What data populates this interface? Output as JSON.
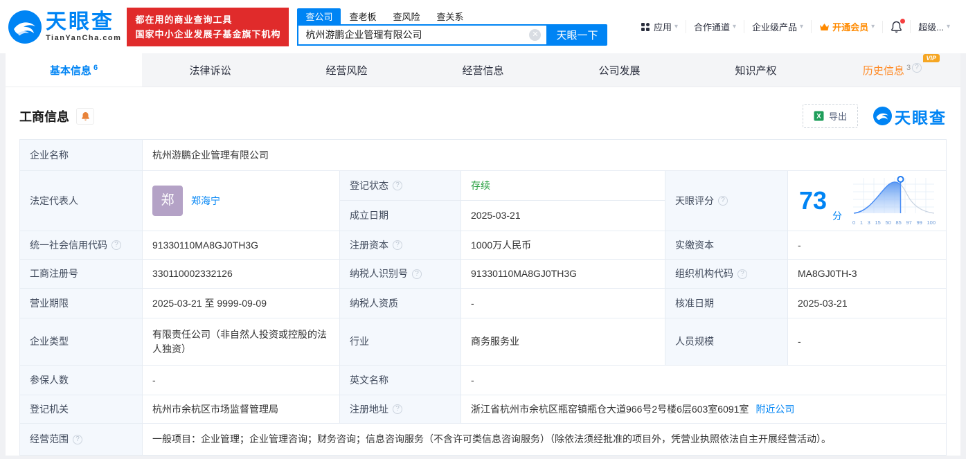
{
  "header": {
    "logo": {
      "name": "天眼查",
      "domain": "TianYanCha.com"
    },
    "promo": {
      "line1": "都在用的商业查询工具",
      "line2": "国家中小企业发展子基金旗下机构"
    },
    "search": {
      "tabs": [
        {
          "label": "查公司"
        },
        {
          "label": "查老板"
        },
        {
          "label": "查风险"
        },
        {
          "label": "查关系"
        }
      ],
      "value": "杭州游鹏企业管理有限公司",
      "button": "天眼一下"
    },
    "nav": {
      "apps": "应用",
      "partner": "合作通道",
      "enterprise": "企业级产品",
      "vip": "开通会员",
      "super": "超级..."
    }
  },
  "tabs": {
    "basic": {
      "label": "基本信息",
      "count": "6"
    },
    "legal": {
      "label": "法律诉讼"
    },
    "risk": {
      "label": "经营风险"
    },
    "operation": {
      "label": "经营信息"
    },
    "development": {
      "label": "公司发展"
    },
    "ip": {
      "label": "知识产权"
    },
    "history": {
      "label": "历史信息",
      "count": "3",
      "vip_badge": "VIP"
    }
  },
  "section": {
    "title": "工商信息",
    "export": "导出",
    "watermark": "天眼查"
  },
  "fields": {
    "company_name": {
      "label": "企业名称",
      "value": "杭州游鹏企业管理有限公司"
    },
    "legal_rep": {
      "label": "法定代表人",
      "avatar_char": "郑",
      "name": "郑海宁"
    },
    "reg_status": {
      "label": "登记状态",
      "value": "存续"
    },
    "establish_date": {
      "label": "成立日期",
      "value": "2025-03-21"
    },
    "score": {
      "label": "天眼评分"
    },
    "credit_code": {
      "label": "统一社会信用代码",
      "value": "91330110MA8GJ0TH3G"
    },
    "reg_capital": {
      "label": "注册资本",
      "value": "1000万人民币"
    },
    "paid_capital": {
      "label": "实缴资本",
      "value": "-"
    },
    "reg_number": {
      "label": "工商注册号",
      "value": "330110002332126"
    },
    "taxpayer_id": {
      "label": "纳税人识别号",
      "value": "91330110MA8GJ0TH3G"
    },
    "org_code": {
      "label": "组织机构代码",
      "value": "MA8GJ0TH-3"
    },
    "business_term": {
      "label": "营业期限",
      "value": "2025-03-21 至 9999-09-09"
    },
    "taxpayer_quality": {
      "label": "纳税人资质",
      "value": "-"
    },
    "approval_date": {
      "label": "核准日期",
      "value": "2025-03-21"
    },
    "company_type": {
      "label": "企业类型",
      "value": "有限责任公司（非自然人投资或控股的法人独资）"
    },
    "industry": {
      "label": "行业",
      "value": "商务服务业"
    },
    "staff_size": {
      "label": "人员规模",
      "value": "-"
    },
    "insured_count": {
      "label": "参保人数",
      "value": "-"
    },
    "english_name": {
      "label": "英文名称",
      "value": "-"
    },
    "reg_authority": {
      "label": "登记机关",
      "value": "杭州市余杭区市场监督管理局"
    },
    "reg_address": {
      "label": "注册地址",
      "value": "浙江省杭州市余杭区瓶窑镇瓶仓大道966号2号楼6层603室6091室",
      "link": "附近公司"
    },
    "business_scope": {
      "label": "经营范围",
      "value": "一般项目：企业管理；企业管理咨询；财务咨询；信息咨询服务（不含许可类信息咨询服务）（除依法须经批准的项目外，凭营业执照依法自主开展经营活动）。"
    }
  },
  "score_chart": {
    "type": "area",
    "score": "73",
    "unit": "分",
    "axis_labels": [
      "0",
      "1",
      "3",
      "15",
      "50",
      "85",
      "97",
      "99",
      "100"
    ],
    "accent_color": "#0084f4",
    "fill_color": "#5896f0"
  }
}
